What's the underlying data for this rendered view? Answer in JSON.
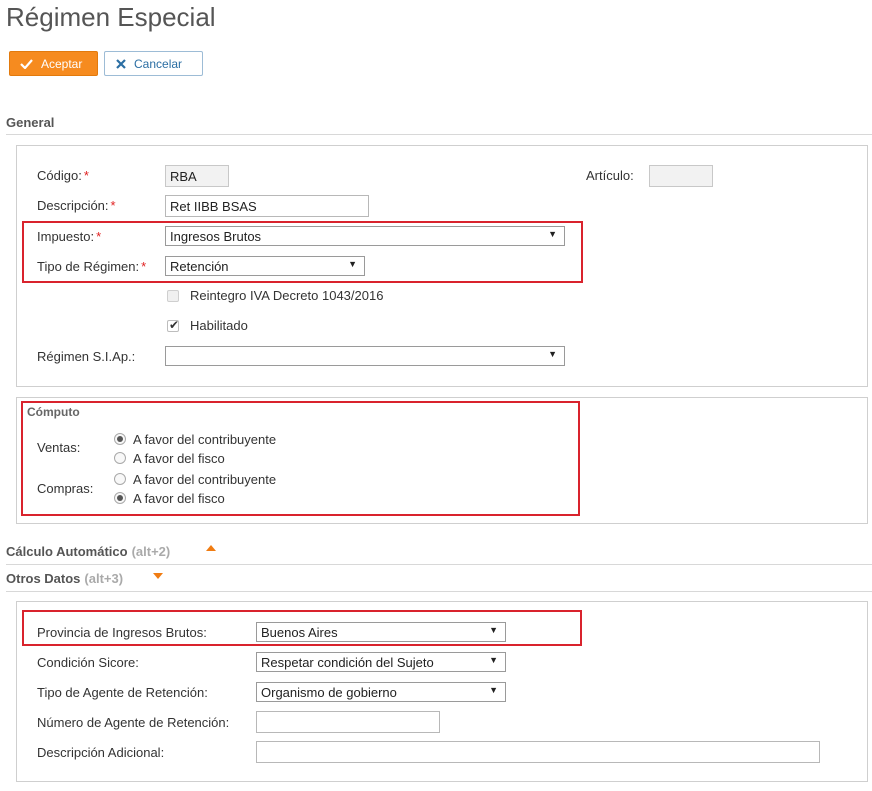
{
  "page": {
    "title": "Régimen Especial"
  },
  "toolbar": {
    "accept_label": "Aceptar",
    "cancel_label": "Cancelar"
  },
  "general": {
    "heading": "General",
    "codigo": {
      "label": "Código:",
      "value": "RBA"
    },
    "articulo": {
      "label": "Artículo:",
      "value": ""
    },
    "descripcion": {
      "label": "Descripción:",
      "value": "Ret IIBB BSAS"
    },
    "impuesto": {
      "label": "Impuesto:",
      "value": "Ingresos Brutos"
    },
    "tipo_regimen": {
      "label": "Tipo de Régimen:",
      "value": "Retención"
    },
    "reintegro": {
      "label": "Reintegro IVA Decreto 1043/2016",
      "checked": false,
      "disabled": true
    },
    "habilitado": {
      "label": "Habilitado",
      "checked": true
    },
    "regimen_siap": {
      "label": "Régimen S.I.Ap.:",
      "value": ""
    },
    "required_mark": "*"
  },
  "computo": {
    "legend": "Cómputo",
    "ventas": {
      "label": "Ventas:",
      "options": [
        "A favor del contribuyente",
        "A favor del fisco"
      ],
      "selected": 0
    },
    "compras": {
      "label": "Compras:",
      "options": [
        "A favor del contribuyente",
        "A favor del fisco"
      ],
      "selected": 1
    }
  },
  "calculo_automatico": {
    "heading": "Cálculo Automático",
    "shortcut": "(alt+2)"
  },
  "otros_datos": {
    "heading": "Otros Datos",
    "shortcut": "(alt+3)",
    "provincia": {
      "label": "Provincia de Ingresos Brutos:",
      "value": "Buenos Aires"
    },
    "condicion_sicore": {
      "label": "Condición Sicore:",
      "value": "Respetar condición del Sujeto"
    },
    "tipo_agente": {
      "label": "Tipo de Agente de Retención:",
      "value": "Organismo de gobierno"
    },
    "numero_agente": {
      "label": "Número de Agente de Retención:",
      "value": ""
    },
    "descripcion_adicional": {
      "label": "Descripción Adicional:",
      "value": ""
    }
  },
  "icons": {
    "accept": "check-icon",
    "cancel": "x-icon",
    "dropdown": "triangle-down-icon",
    "collapse": "triangle-up-icon",
    "expand": "triangle-down-icon"
  },
  "colors": {
    "accent": "#f68b1f",
    "cancel_text": "#2b6ea3",
    "highlight": "#d9232d",
    "required": "#e02020"
  }
}
